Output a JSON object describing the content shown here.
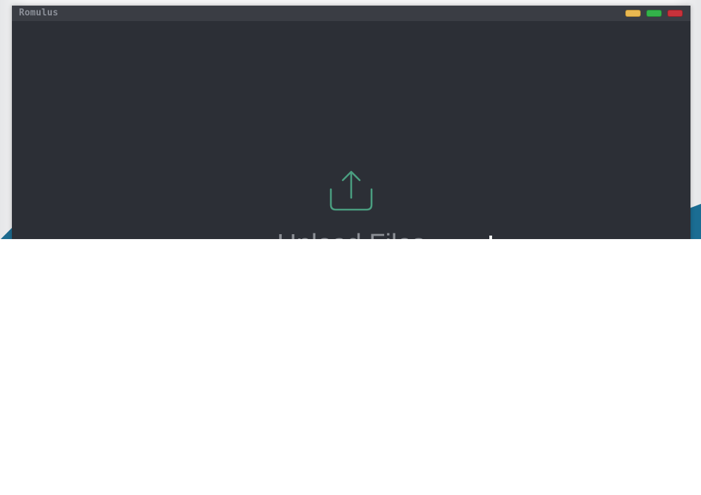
{
  "window": {
    "title": "Romulus",
    "controls": [
      {
        "name": "minimize",
        "color": "#e9b851"
      },
      {
        "name": "maximize",
        "color": "#33b34a"
      },
      {
        "name": "close",
        "color": "#c8323b"
      }
    ]
  },
  "upload": {
    "icon": "upload-icon",
    "label": "Upload Files",
    "icon_color": "#4a9e80"
  },
  "colors": {
    "window_bg": "#2c2f36",
    "titlebar_bg": "#3a3d44",
    "accent_blue": "#1d6b8f"
  }
}
